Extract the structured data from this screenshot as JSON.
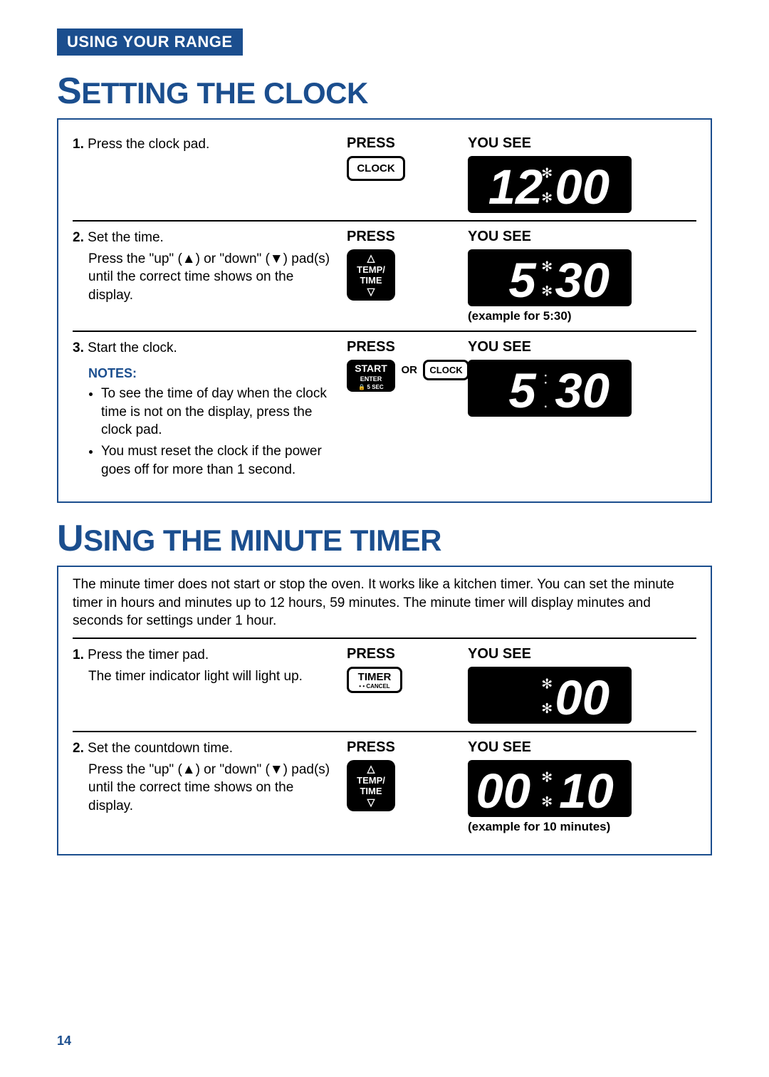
{
  "header": {
    "title": "USING YOUR RANGE"
  },
  "pageNumber": "14",
  "section1": {
    "title": "SETTING THE CLOCK",
    "col_press": "PRESS",
    "col_yousee": "YOU SEE",
    "step1": {
      "num": "1.",
      "text": "Press the clock pad.",
      "button_label": "CLOCK",
      "display": "12:00"
    },
    "step2": {
      "num": "2.",
      "text": "Set the time.",
      "sub": "Press the \"up\" (▲) or \"down\" (▼) pad(s) until the correct time shows on the display.",
      "button_line1": "TEMP/",
      "button_line2": "TIME",
      "display": "5:30",
      "caption": "(example for 5:30)"
    },
    "step3": {
      "num": "3.",
      "text": "Start the clock.",
      "notes_label": "NOTES:",
      "note1": "To see the time of day when the clock time is not on the display, press the clock pad.",
      "note2": "You must reset the clock if the power goes off for more than 1 second.",
      "start_label": "START",
      "start_sub1": "ENTER",
      "start_sub2": "🔒 5 SEC",
      "or": "OR",
      "clock_label": "CLOCK",
      "display": "5:30"
    }
  },
  "section2": {
    "title": "USING THE MINUTE TIMER",
    "intro": "The minute timer does not start or stop the oven. It works like a kitchen timer. You can set the minute timer in hours and minutes up to 12 hours, 59 minutes. The minute timer will display minutes and seconds for settings under 1 hour.",
    "col_press": "PRESS",
    "col_yousee": "YOU SEE",
    "step1": {
      "num": "1.",
      "text": "Press the timer pad.",
      "sub": "The timer indicator light will light up.",
      "button_label": "TIMER",
      "button_sub": "• • CANCEL",
      "display": ":00"
    },
    "step2": {
      "num": "2.",
      "text": "Set the countdown time.",
      "sub": "Press the \"up\" (▲) or \"down\" (▼) pad(s) until the correct time shows on the display.",
      "button_line1": "TEMP/",
      "button_line2": "TIME",
      "display": "00:10",
      "caption": "(example for 10 minutes)"
    }
  }
}
